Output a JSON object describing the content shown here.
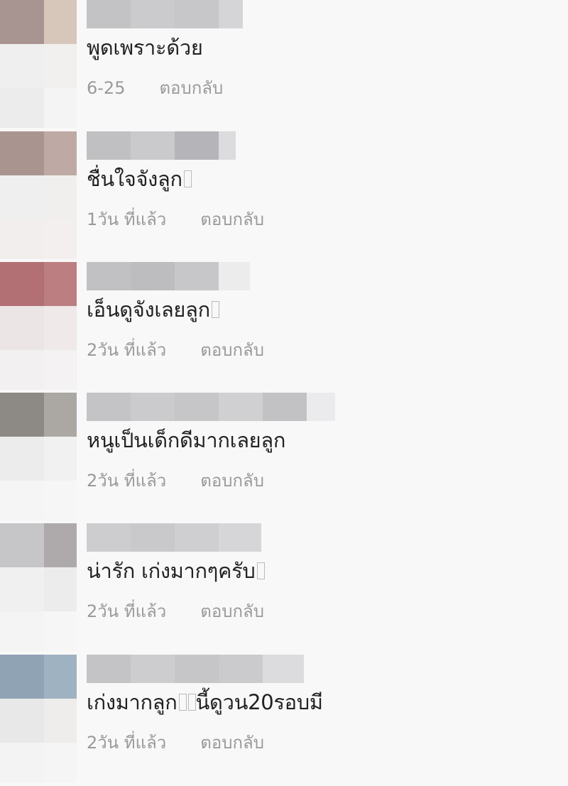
{
  "comments": [
    {
      "text": "พูดเพราะด้วย",
      "time": "6-25",
      "reply": "ตอบกลับ",
      "avatar_colors": [
        "#a89591",
        "#d7c7bb",
        "#efefef",
        "#f2f0ee",
        "#ececec",
        "#f4f4f4"
      ],
      "name_colors": [
        "#c3c3c6",
        "#cbcbce",
        "#c7c7ca",
        "#d5d5d7"
      ]
    },
    {
      "text": "ชื่นใจจังลูก",
      "time": "1วัน ที่แล้ว",
      "reply": "ตอบกลับ",
      "avatar_colors": [
        "#a99490",
        "#bea9a4",
        "#efefef",
        "#f0efee",
        "#f3eeee",
        "#f3efef"
      ],
      "name_colors": [
        "#c0c0c3",
        "#cacacc",
        "#b5b4b8",
        "#dcdcde"
      ]
    },
    {
      "text": "เอ็นดูจังเลยลูก",
      "time": "2วัน ที่แล้ว",
      "reply": "ตอบกลับ",
      "avatar_colors": [
        "#b26f74",
        "#bd7e82",
        "#ebe5e5",
        "#efe9e9",
        "#f2f0f0",
        "#f4f2f2"
      ],
      "name_colors": [
        "#c1c1c4",
        "#bdbdc0",
        "#c7c7ca",
        "#ececed"
      ]
    },
    {
      "text": "หนูเป็นเด็กดีมากเลยลูก",
      "time": "2วัน ที่แล้ว",
      "reply": "ตอบกลับ",
      "avatar_colors": [
        "#8d8985",
        "#aba8a4",
        "#ececec",
        "#f1f1f1",
        "#f5f5f5",
        "#f6f6f6"
      ],
      "name_colors": [
        "#c4c4c7",
        "#cbcbcd",
        "#c6c6c9",
        "#d0d0d2",
        "#c2c2c5",
        "#ebebed"
      ]
    },
    {
      "text": "น่ารัก เก่งมากๆครับ",
      "time": "2วัน ที่แล้ว",
      "reply": "ตอบกลับ",
      "avatar_colors": [
        "#c6c5c8",
        "#aeaaab",
        "#f0f0f1",
        "#ececec",
        "#f4f4f5",
        "#f6f6f6"
      ],
      "name_colors": [
        "#cdcdd0",
        "#c9c9cc",
        "#cfcfd1",
        "#d6d6d8"
      ]
    },
    {
      "text": "เก่งมากลูก",
      "text_tail": "นี้ดูวน20รอบมี",
      "time": "2วัน ที่แล้ว",
      "reply": "ตอบกลับ",
      "avatar_colors": [
        "#8fa3b5",
        "#9fb2c2",
        "#e8e8e8",
        "#efecec",
        "#f3f3f3",
        "#f5f5f5"
      ],
      "name_colors": [
        "#c4c4c7",
        "#cdcdcf",
        "#c6c6c9",
        "#cbcbcd",
        "#dcdcde"
      ]
    }
  ]
}
